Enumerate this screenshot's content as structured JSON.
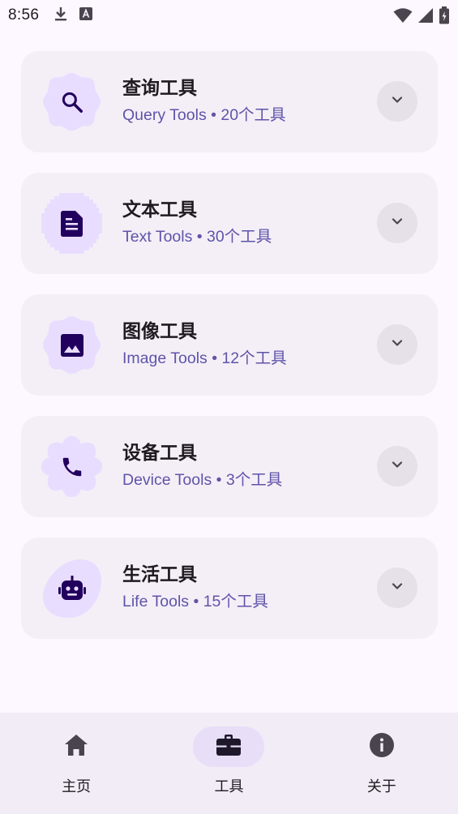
{
  "status_bar": {
    "time": "8:56",
    "left_icons": [
      "download-icon",
      "keyboard-a-icon"
    ],
    "right_icons": [
      "wifi-icon",
      "signal-icon",
      "battery-icon"
    ]
  },
  "categories": [
    {
      "title": "查询工具",
      "subtitle": "Query Tools • 20个工具",
      "icon": "search-icon",
      "shape": "cookie"
    },
    {
      "title": "文本工具",
      "subtitle": "Text Tools • 30个工具",
      "icon": "document-icon",
      "shape": "pixel"
    },
    {
      "title": "图像工具",
      "subtitle": "Image Tools • 12个工具",
      "icon": "image-icon",
      "shape": "cookie"
    },
    {
      "title": "设备工具",
      "subtitle": "Device Tools • 3个工具",
      "icon": "phone-icon",
      "shape": "flower"
    },
    {
      "title": "生活工具",
      "subtitle": "Life Tools • 15个工具",
      "icon": "robot-icon",
      "shape": "blob"
    }
  ],
  "bottom_nav": {
    "items": [
      {
        "label": "主页",
        "icon": "home-icon",
        "active": false
      },
      {
        "label": "工具",
        "icon": "toolbox-icon",
        "active": true
      },
      {
        "label": "关于",
        "icon": "info-icon",
        "active": false
      }
    ]
  },
  "colors": {
    "background": "#fdf7ff",
    "card": "#f4eff7",
    "icon_shape": "#e9ddff",
    "icon_glyph": "#22005d",
    "subtitle": "#5f54a8",
    "expand_button": "#e6e0e9",
    "nav_bar": "#f2ecf6",
    "nav_active_pill": "#e8def8"
  }
}
